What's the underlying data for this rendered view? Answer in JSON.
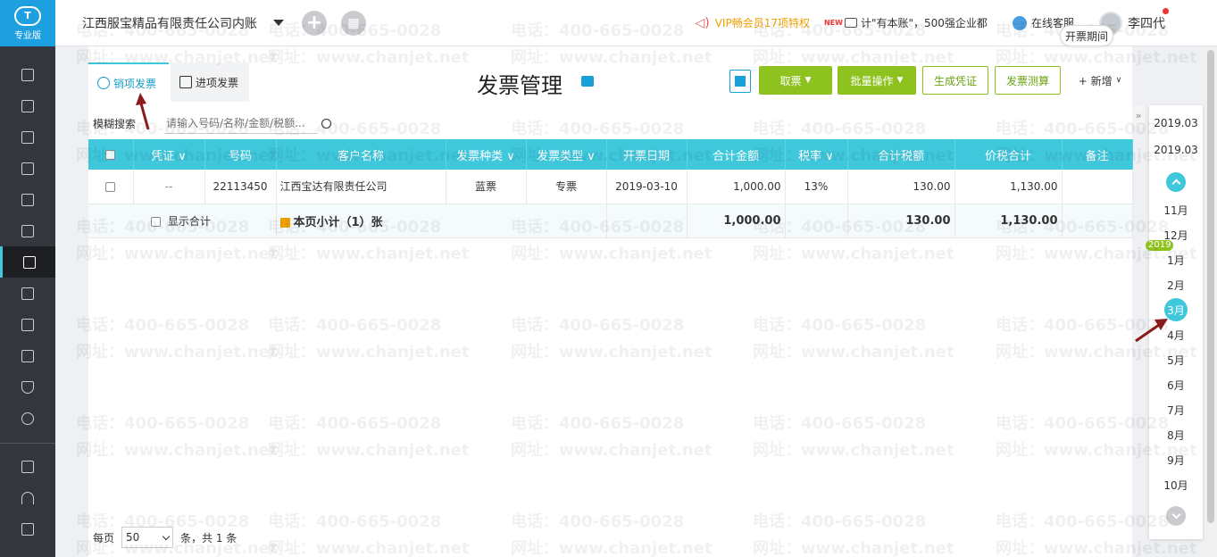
{
  "app": {
    "edition_label": "专业版",
    "logo_mark": "T"
  },
  "topbar": {
    "company": "江西服宝精品有限责任公司内账",
    "vip_text": "VIP畅会员17项特权",
    "news_tag": "NEW",
    "news_text": "计\"有本账\"，500强企业都",
    "service_text": "在线客服",
    "user_name": "李四代"
  },
  "sidebar": {
    "items": [
      {
        "name": "sidebar-item-1",
        "icon": "ledger-icon"
      },
      {
        "name": "sidebar-item-2",
        "icon": "voucher-icon"
      },
      {
        "name": "sidebar-item-3",
        "icon": "report-chart-icon"
      },
      {
        "name": "sidebar-item-4",
        "icon": "building-icon"
      },
      {
        "name": "sidebar-item-5",
        "icon": "calendar-icon"
      },
      {
        "name": "sidebar-item-6",
        "icon": "book-icon"
      },
      {
        "name": "sidebar-item-invoice",
        "icon": "invoice-icon",
        "active": true
      },
      {
        "name": "sidebar-item-8",
        "icon": "chart-panel-icon"
      },
      {
        "name": "sidebar-item-9",
        "icon": "tax-icon"
      },
      {
        "name": "sidebar-item-10",
        "icon": "document-icon"
      },
      {
        "name": "sidebar-item-11",
        "icon": "shield-icon"
      },
      {
        "name": "sidebar-item-12",
        "icon": "gear-icon"
      }
    ],
    "bottom_items": [
      {
        "name": "sidebar-item-video",
        "icon": "video-icon"
      },
      {
        "name": "sidebar-item-speed",
        "icon": "speed-icon"
      },
      {
        "name": "sidebar-item-doc",
        "icon": "doc-icon"
      }
    ]
  },
  "page": {
    "title": "发票管理",
    "tabs": [
      {
        "label": "销项发票",
        "active": true
      },
      {
        "label": "进项发票",
        "active": false
      }
    ],
    "buttons": {
      "fetch": "取票",
      "batch": "批量操作",
      "gen_voucher": "生成凭证",
      "invoice_calc": "发票测算",
      "add": "+ 新增"
    },
    "period_button": "开票期间"
  },
  "search": {
    "mode": "模糊搜索",
    "placeholder": "请输入号码/名称/金额/税额..."
  },
  "table": {
    "columns": [
      "",
      "凭证",
      "号码",
      "客户名称",
      "发票种类",
      "发票类型",
      "开票日期",
      "合计金额",
      "税率",
      "合计税额",
      "价税合计",
      "备注"
    ],
    "dropdown_columns": [
      1,
      4,
      5,
      8
    ],
    "rows": [
      {
        "voucher": "--",
        "number": "22113450",
        "customer": "江西宝达有限责任公司",
        "kind": "蓝票",
        "type": "专票",
        "date": "2019-03-10",
        "amount": "1,000.00",
        "rate": "13%",
        "tax": "130.00",
        "total": "1,130.00",
        "remark": ""
      }
    ],
    "subtotal": {
      "show_total_label": "显示合计",
      "label": "本页小计（1）张",
      "amount": "1,000.00",
      "tax": "130.00",
      "total": "1,130.00"
    }
  },
  "pager": {
    "per_page_label": "每页",
    "per_page_value": "50",
    "summary": "条，共 1 条"
  },
  "period": {
    "range_start": "2019.03",
    "range_end": "2019.03",
    "year_tag": "2019",
    "months": [
      "11月",
      "12月",
      "1月",
      "2月",
      "3月",
      "4月",
      "5月",
      "6月",
      "7月",
      "8月",
      "9月",
      "10月"
    ],
    "selected_month": "3月"
  },
  "watermark": {
    "phone": "电话：400-665-0028",
    "site": "网址：www.chanjet.net"
  },
  "colors": {
    "accent": "#3fc7dc",
    "green": "#8dc21f",
    "sidebar": "#33363d",
    "logo": "#1ea0e0"
  }
}
